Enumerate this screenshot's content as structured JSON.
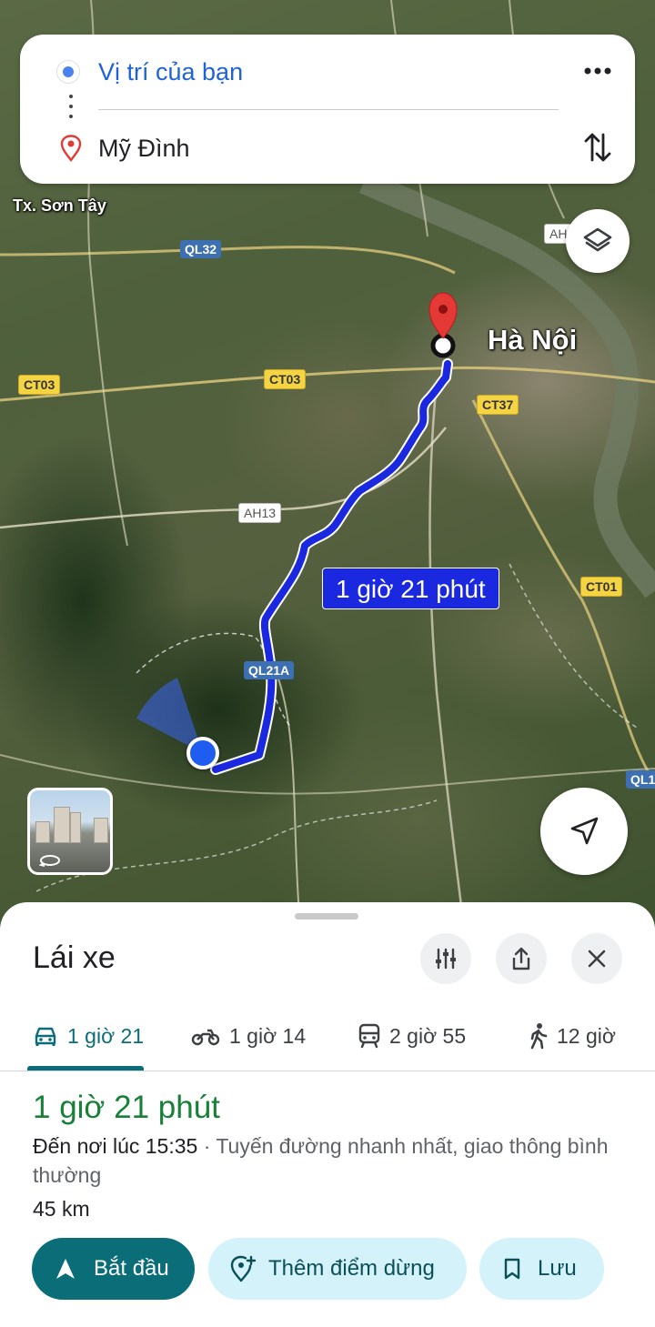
{
  "directions": {
    "origin": "Vị trí của bạn",
    "destination": "Mỹ Đình"
  },
  "map": {
    "city_labels": {
      "son_tay": "Tx. Sơn Tây",
      "ha_noi": "Hà Nội"
    },
    "road_labels": {
      "ql32": "QL32",
      "ct03_left": "CT03",
      "ct03_mid": "CT03",
      "ct37": "CT37",
      "ah13": "AH13",
      "ah_top": "AH",
      "ct01": "CT01",
      "ql21a": "QL21A",
      "ql1": "QL1"
    },
    "route_duration_badge": "1 giờ 21 phút",
    "route_color": "#1a28e0"
  },
  "sheet": {
    "title": "Lái xe",
    "modes": [
      {
        "icon": "car-icon",
        "label": "1 giờ 21",
        "selected": true
      },
      {
        "icon": "motorbike-icon",
        "label": "1 giờ 14",
        "selected": false
      },
      {
        "icon": "transit-icon",
        "label": "2 giờ 55",
        "selected": false
      },
      {
        "icon": "walk-icon",
        "label": "12 giờ",
        "selected": false
      }
    ],
    "duration": "1 giờ 21 phút",
    "arrival": "Đến nơi lúc 15:35",
    "route_note": " · Tuyến đường nhanh nhất, giao thông bình thường",
    "distance": "45 km",
    "actions": {
      "start": "Bắt đầu",
      "add_stop": "Thêm điểm dừng",
      "save": "Lưu"
    }
  },
  "colors": {
    "accent_teal": "#0b6d78",
    "duration_green": "#188038",
    "origin_blue": "#1f63d6",
    "pill_bg": "#d3f2f9",
    "pin_red": "#e53935"
  }
}
